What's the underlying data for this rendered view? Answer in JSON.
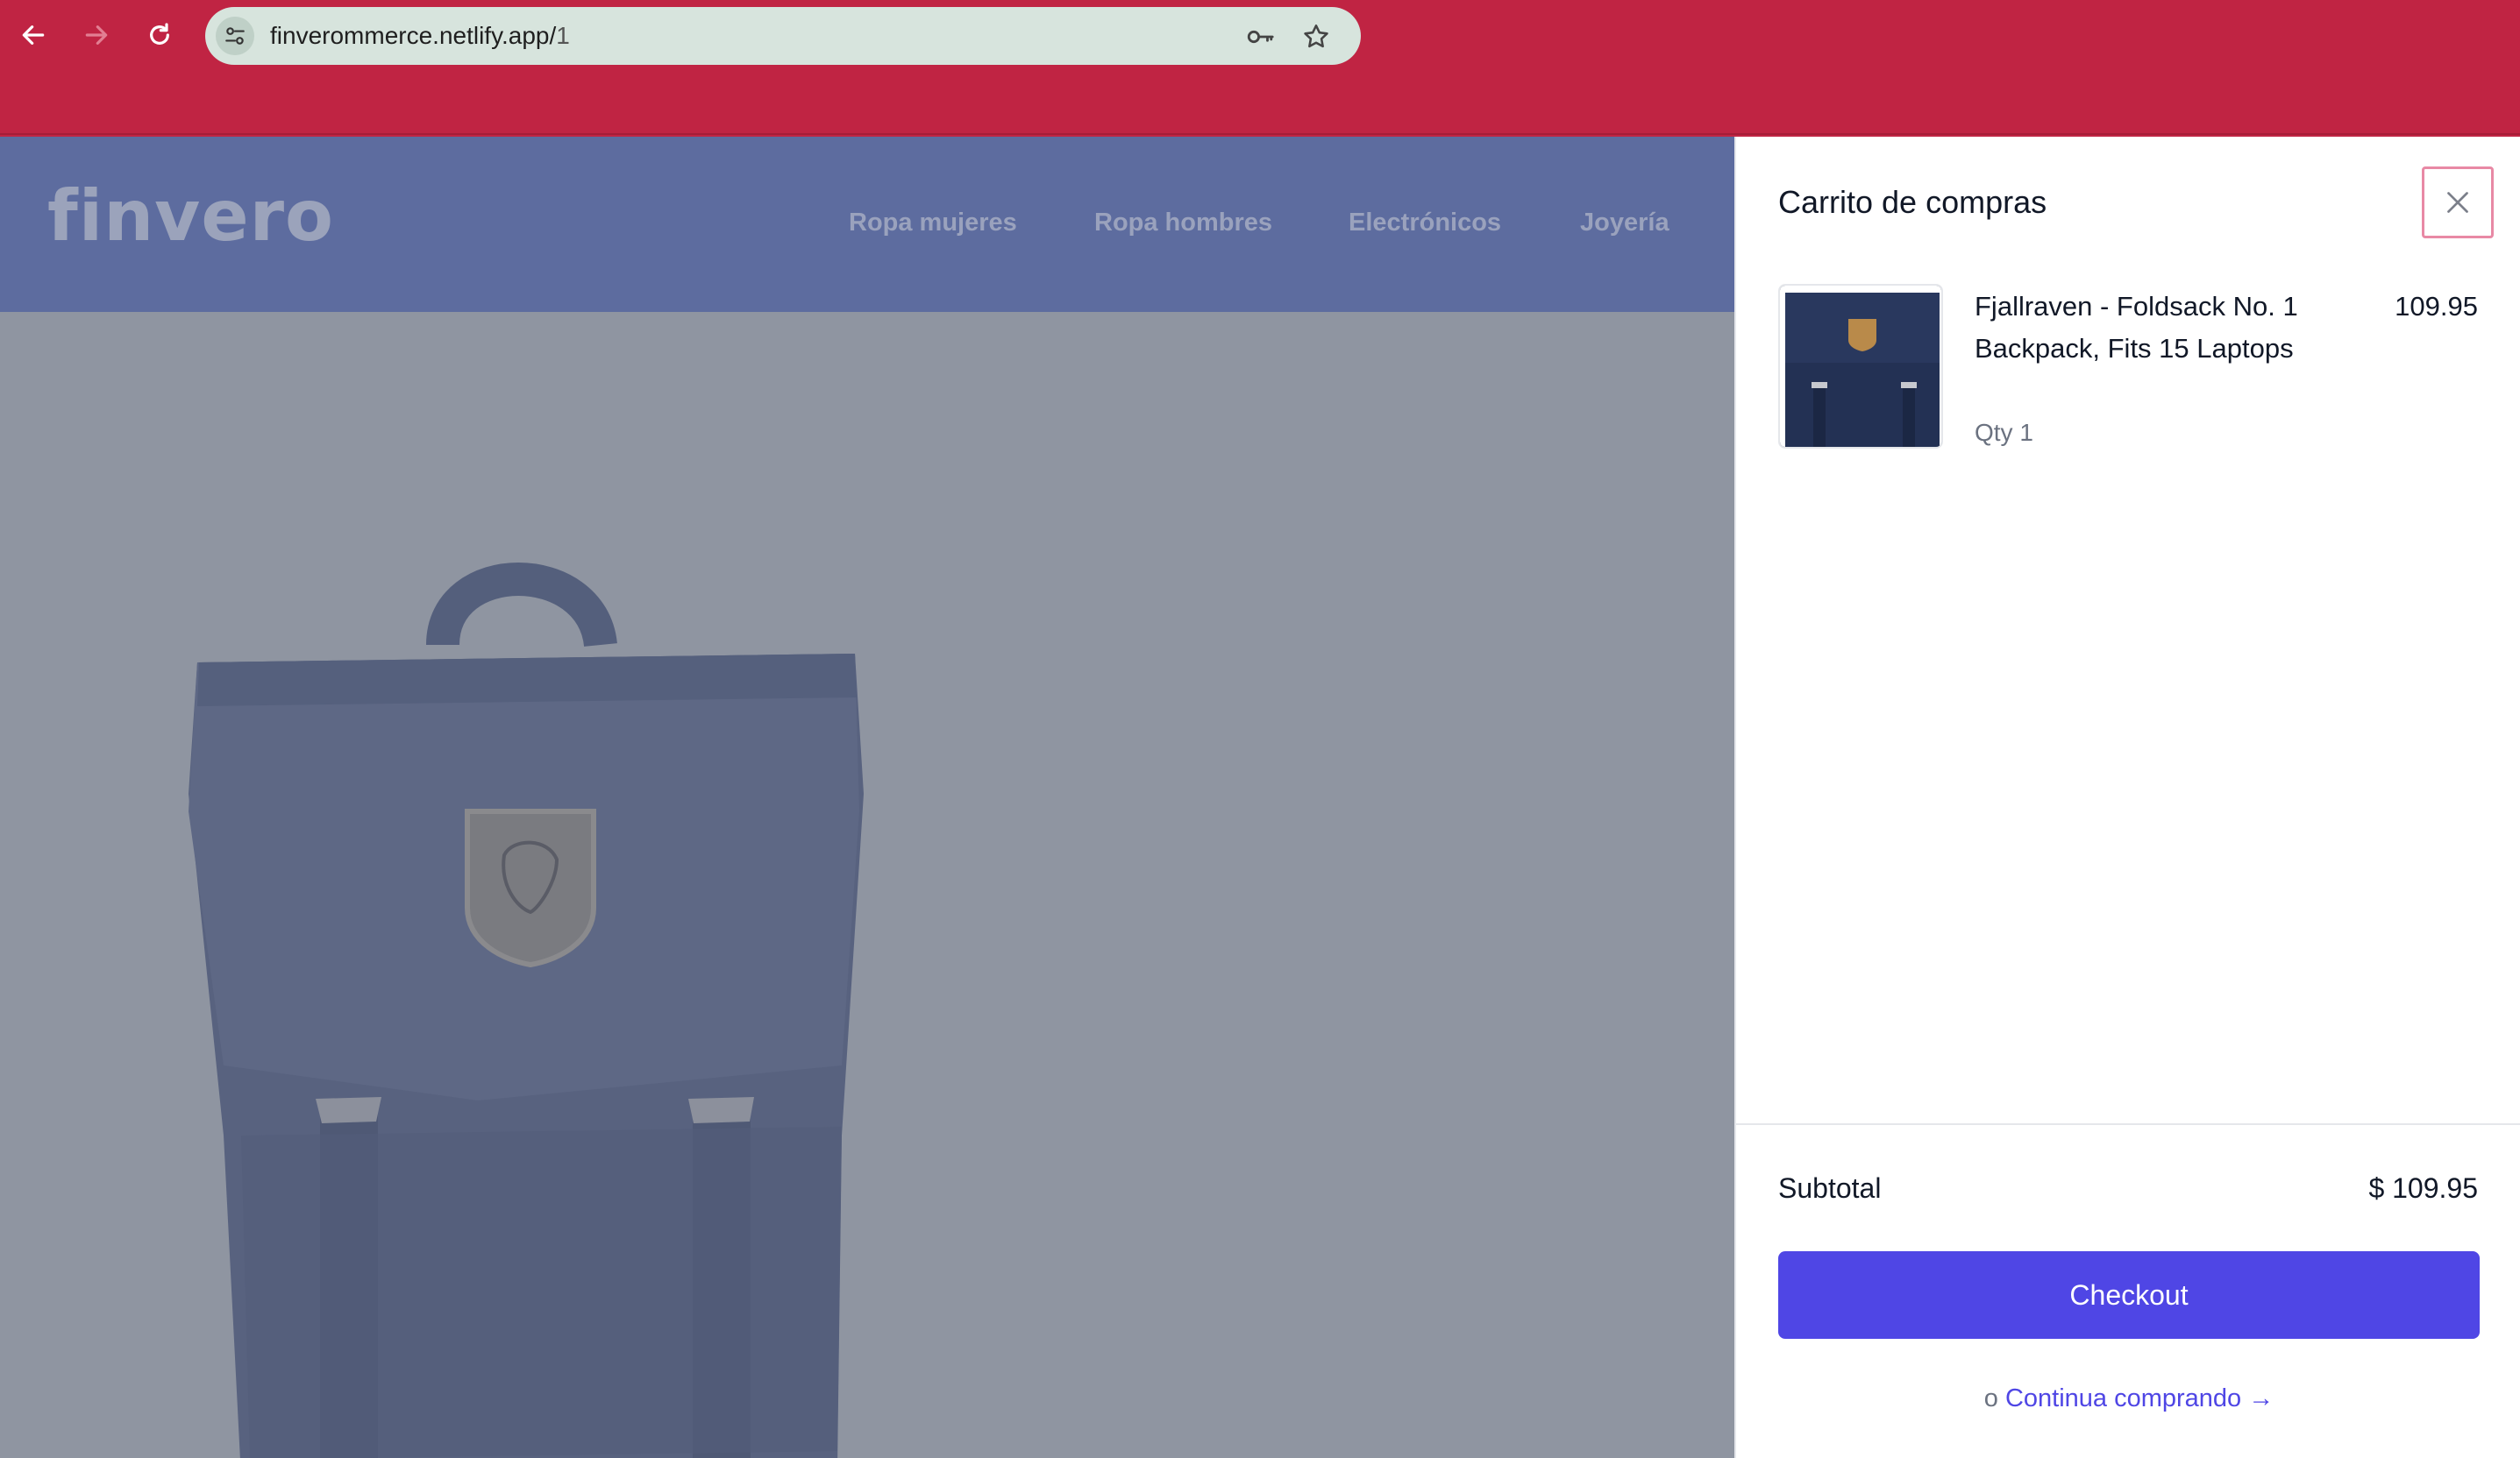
{
  "browser": {
    "url_host": "finverommerce.netlify.app/",
    "url_path": "1",
    "icons": {
      "back": "arrow-left-icon",
      "forward": "arrow-right-icon",
      "reload": "reload-icon",
      "site_info": "tune-icon",
      "password": "key-icon",
      "bookmark": "star-icon"
    },
    "frame_color": "#c02443"
  },
  "site": {
    "logo": "finvero",
    "nav": [
      "Ropa mujeres",
      "Ropa hombres",
      "Electrónicos",
      "Joyería"
    ],
    "header_color": "#5d6c9f"
  },
  "cart": {
    "title": "Carrito de compras",
    "items": [
      {
        "name": "Fjallraven - Foldsack No. 1 Backpack, Fits 15 Laptops",
        "price": "109.95",
        "qty": "Qty 1"
      }
    ],
    "subtotal_label": "Subtotal",
    "subtotal_value": "$ 109.95",
    "checkout_label": "Checkout",
    "continue_prefix": "o",
    "continue_label": "Continua comprando →",
    "accent": "#4f46e5"
  }
}
